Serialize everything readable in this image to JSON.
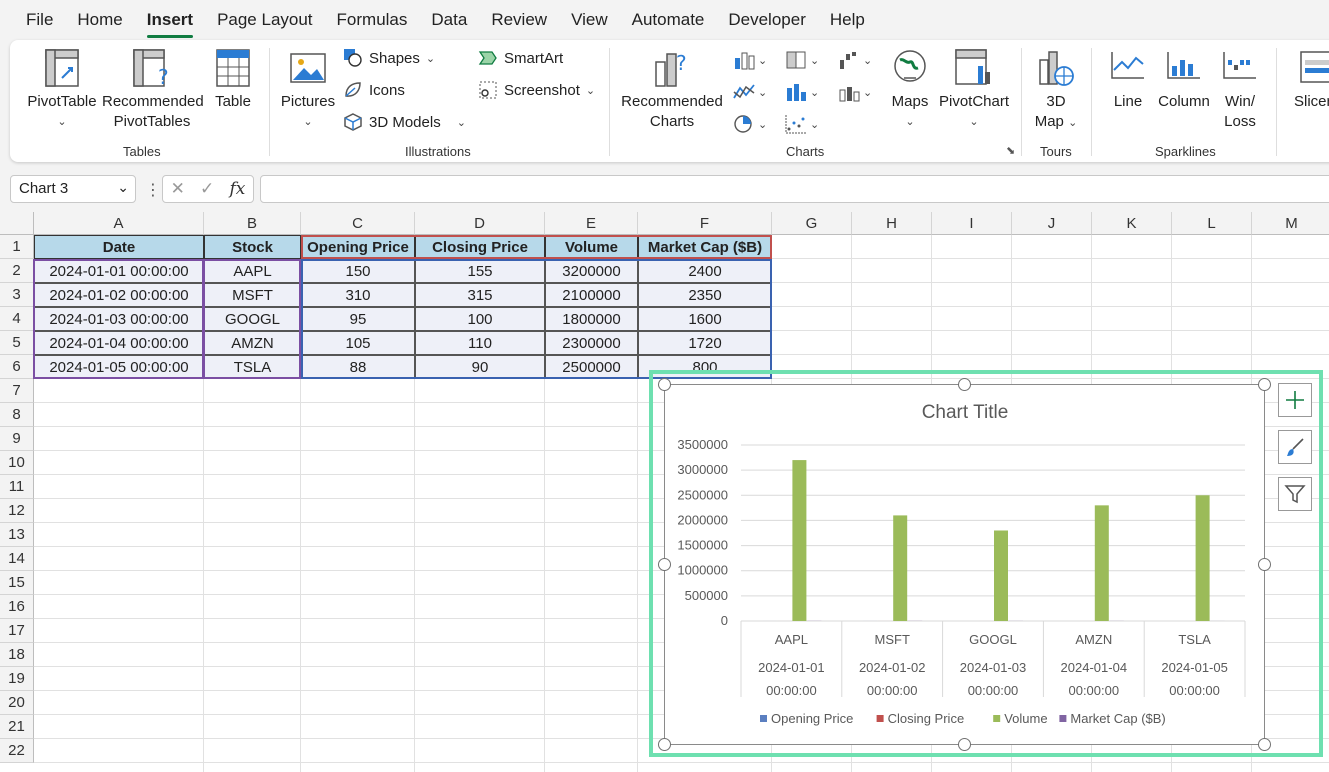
{
  "menu": [
    "File",
    "Home",
    "Insert",
    "Page Layout",
    "Formulas",
    "Data",
    "Review",
    "View",
    "Automate",
    "Developer",
    "Help"
  ],
  "ribbon": {
    "tables": {
      "label": "Tables",
      "pivottable": "PivotTable",
      "recommended_pivot_1": "Recommended",
      "recommended_pivot_2": "PivotTables",
      "table": "Table"
    },
    "illustrations": {
      "label": "Illustrations",
      "pictures": "Pictures",
      "shapes": "Shapes",
      "icons": "Icons",
      "models": "3D Models",
      "smartart": "SmartArt",
      "screenshot": "Screenshot"
    },
    "charts": {
      "label": "Charts",
      "recommended_1": "Recommended",
      "recommended_2": "Charts",
      "maps": "Maps",
      "pivotchart": "PivotChart"
    },
    "tours": {
      "label": "Tours",
      "map3d_1": "3D",
      "map3d_2": "Map"
    },
    "sparklines": {
      "label": "Sparklines",
      "line": "Line",
      "column": "Column",
      "winloss_1": "Win/",
      "winloss_2": "Loss"
    },
    "slicer": "Slicer"
  },
  "formula_bar": {
    "name_box": "Chart 3",
    "fx": "fx",
    "formula": ""
  },
  "columns": [
    "A",
    "B",
    "C",
    "D",
    "E",
    "F",
    "G",
    "H",
    "I",
    "J",
    "K",
    "L",
    "M"
  ],
  "rows": [
    "1",
    "2",
    "3",
    "4",
    "5",
    "6",
    "7",
    "8",
    "9",
    "10",
    "11",
    "12",
    "13",
    "14",
    "15",
    "16",
    "17",
    "18",
    "19",
    "20",
    "21",
    "22"
  ],
  "table": {
    "headers": [
      "Date",
      "Stock",
      "Opening Price",
      "Closing Price",
      "Volume",
      "Market Cap ($B)"
    ],
    "rows": [
      [
        "2024-01-01 00:00:00",
        "AAPL",
        "150",
        "155",
        "3200000",
        "2400"
      ],
      [
        "2024-01-02 00:00:00",
        "MSFT",
        "310",
        "315",
        "2100000",
        "2350"
      ],
      [
        "2024-01-03 00:00:00",
        "GOOGL",
        "95",
        "100",
        "1800000",
        "1600"
      ],
      [
        "2024-01-04 00:00:00",
        "AMZN",
        "105",
        "110",
        "2300000",
        "1720"
      ],
      [
        "2024-01-05 00:00:00",
        "TSLA",
        "88",
        "90",
        "2500000",
        "800"
      ]
    ]
  },
  "colors": {
    "accent": "#107c41",
    "header_fill": "#b7d9ea",
    "data_fill": "#eef0f8",
    "selection": "#6ee0b0"
  },
  "chart_data": {
    "type": "bar",
    "title": "Chart Title",
    "categories": [
      [
        "AAPL",
        "2024-01-01",
        "00:00:00"
      ],
      [
        "MSFT",
        "2024-01-02",
        "00:00:00"
      ],
      [
        "GOOGL",
        "2024-01-03",
        "00:00:00"
      ],
      [
        "AMZN",
        "2024-01-04",
        "00:00:00"
      ],
      [
        "TSLA",
        "2024-01-05",
        "00:00:00"
      ]
    ],
    "series": [
      {
        "name": "Opening Price",
        "values": [
          150,
          310,
          95,
          105,
          88
        ],
        "color": "#5b7fc0"
      },
      {
        "name": "Closing Price",
        "values": [
          155,
          315,
          100,
          110,
          90
        ],
        "color": "#c0504d"
      },
      {
        "name": "Volume",
        "values": [
          3200000,
          2100000,
          1800000,
          2300000,
          2500000
        ],
        "color": "#9bbb59"
      },
      {
        "name": "Market Cap ($B)",
        "values": [
          2400,
          2350,
          1600,
          1720,
          800
        ],
        "color": "#8064a2"
      }
    ],
    "yticks": [
      "0",
      "500000",
      "1000000",
      "1500000",
      "2000000",
      "2500000",
      "3000000",
      "3500000"
    ],
    "ylim": [
      0,
      3500000
    ],
    "grid": true,
    "legend": "bottom"
  }
}
